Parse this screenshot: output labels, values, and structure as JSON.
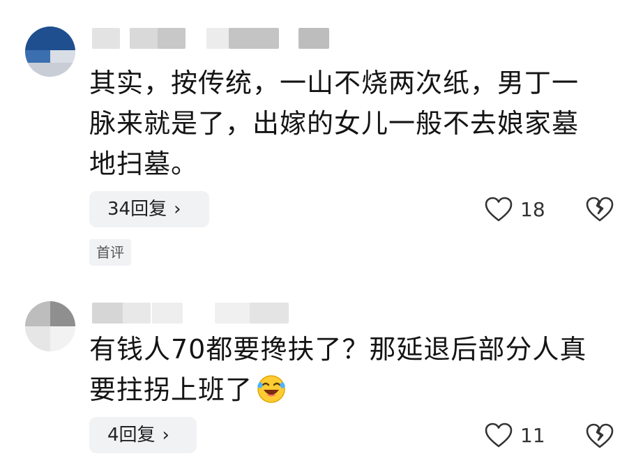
{
  "comments": [
    {
      "text_lines": [
        "其实，按传统，一山不烧两次纸，男丁一",
        "脉来就是了，出嫁的女儿一般不去娘家墓",
        "地扫墓。"
      ],
      "reply_label": "34回复",
      "likes": "18",
      "badge": "首评"
    },
    {
      "text_lines": [
        "有钱人70都要搀扶了？那延退后部分人真",
        "要拄拐上班了"
      ],
      "emoji": "laughing-crying-emoji",
      "reply_label": "4回复",
      "likes": "11"
    }
  ],
  "icons": {
    "reply_chevron": "chevron-right-icon",
    "like": "heart-outline-icon",
    "dislike": "broken-heart-icon"
  },
  "colors": {
    "chip_bg": "#f1f2f4",
    "text": "#141414",
    "icon": "#333333"
  }
}
